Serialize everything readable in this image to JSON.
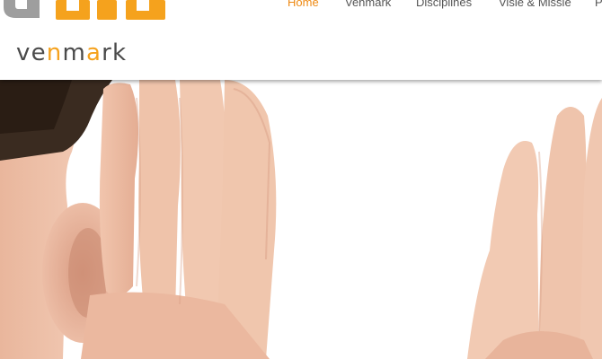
{
  "brand": {
    "logo_prefix": "ve",
    "logo_n": "n",
    "logo_m": "m",
    "logo_a": "a",
    "logo_suffix": "rk",
    "accent_color": "#f5a21d",
    "mark_color": "#9e9e9e"
  },
  "nav": {
    "items": [
      {
        "label": "Home",
        "active": true
      },
      {
        "label": "Venmark",
        "active": false
      },
      {
        "label": "Disciplines",
        "active": false
      },
      {
        "label": "Visie & Missie",
        "active": false
      },
      {
        "label": "P",
        "active": false
      }
    ],
    "active_color": "#ee8a13",
    "text_color": "#555555"
  },
  "hero": {
    "subject": "person cupping hand to ear, second hand raised on right"
  }
}
